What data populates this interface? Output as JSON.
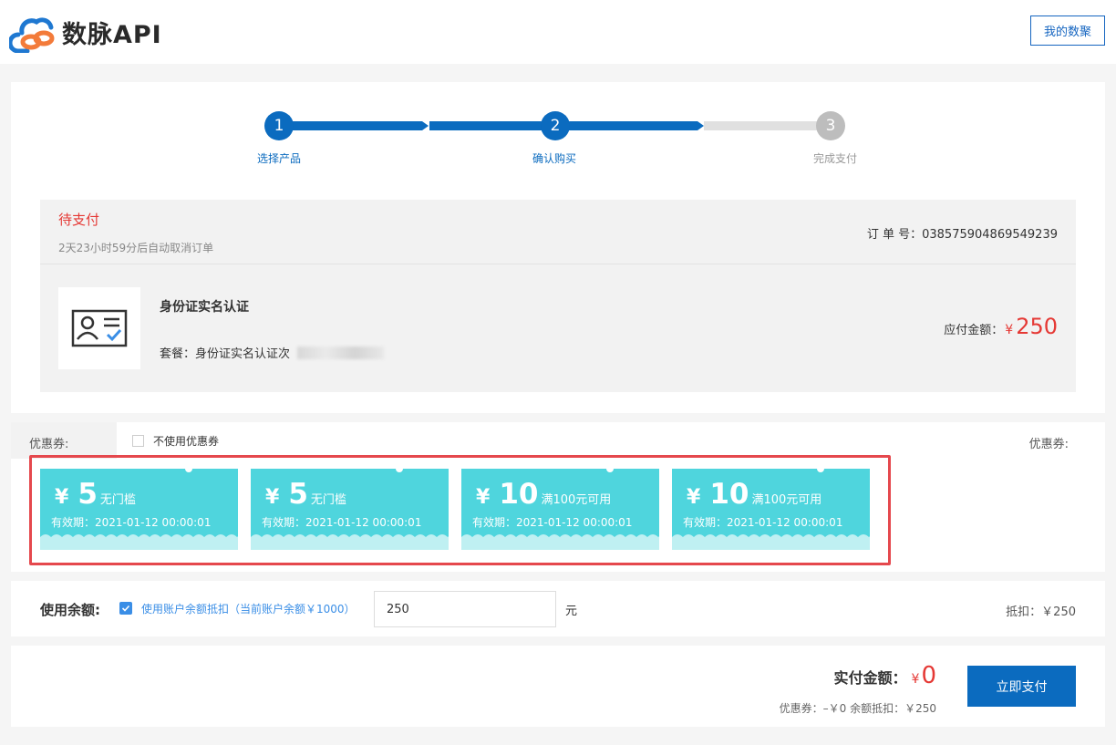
{
  "header": {
    "logo_text": "数脉API",
    "my_button": "我的数聚"
  },
  "steps": [
    {
      "num": "1",
      "label": "选择产品",
      "state": "active"
    },
    {
      "num": "2",
      "label": "确认购买",
      "state": "active"
    },
    {
      "num": "3",
      "label": "完成支付",
      "state": "inactive"
    }
  ],
  "order": {
    "status": "待支付",
    "countdown": "2天23小时59分后自动取消订单",
    "order_no_label": "订 单 号：",
    "order_no": "038575904869549239",
    "product_name": "身份证实名认证",
    "package_label": "套餐：身份证实名认证次",
    "amount_label": "应付金额：",
    "amount_currency": "¥",
    "amount_value": "250"
  },
  "coupons": {
    "tab_label": "优惠券:",
    "no_coupon_label": "不使用优惠券",
    "right_label": "优惠券:",
    "items": [
      {
        "currency": "¥",
        "amount": "5",
        "condition": "无门槛",
        "validity": "有效期：2021-01-12 00:00:01"
      },
      {
        "currency": "¥",
        "amount": "5",
        "condition": "无门槛",
        "validity": "有效期：2021-01-12 00:00:01"
      },
      {
        "currency": "¥",
        "amount": "10",
        "condition": "满100元可用",
        "validity": "有效期：2021-01-12 00:00:01"
      },
      {
        "currency": "¥",
        "amount": "10",
        "condition": "满100元可用",
        "validity": "有效期：2021-01-12 00:00:01"
      }
    ]
  },
  "balance": {
    "label": "使用余额:",
    "checkbox_text": "使用账户余额抵扣（当前账户余额￥1000）",
    "input_value": "250",
    "unit": "元",
    "deduct": "抵扣：￥250"
  },
  "payment": {
    "total_label": "实付金额：",
    "total_currency": "¥",
    "total_value": "0",
    "detail": "优惠券：–￥0  余额抵扣：￥250",
    "pay_button": "立即支付"
  },
  "colors": {
    "primary": "#0b6bbf",
    "accent_red": "#e53935",
    "coupon": "#4fd5dd"
  }
}
